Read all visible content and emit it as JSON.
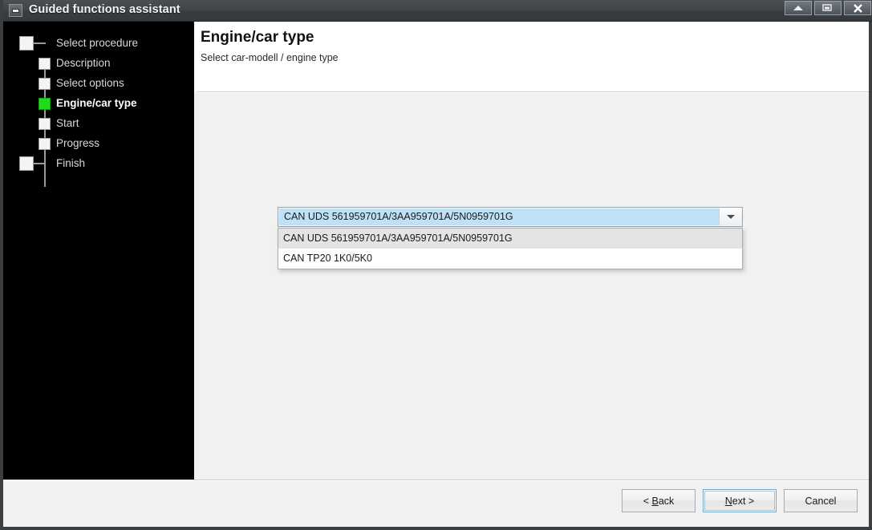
{
  "window": {
    "title": "Guided functions assistant",
    "sysmenu_icon": "window-menu-icon",
    "controls": [
      {
        "name": "minimize-button",
        "icon": "triangle-up-icon"
      },
      {
        "name": "restore-button",
        "icon": "restore-window-icon"
      },
      {
        "name": "close-button",
        "icon": "close-x-icon"
      }
    ]
  },
  "sidebar": {
    "steps": [
      {
        "label": "Select procedure",
        "state": "pending",
        "level": "outer"
      },
      {
        "label": "Description",
        "state": "pending",
        "level": "inner"
      },
      {
        "label": "Select options",
        "state": "pending",
        "level": "inner"
      },
      {
        "label": "Engine/car type",
        "state": "current",
        "level": "inner"
      },
      {
        "label": "Start",
        "state": "pending",
        "level": "inner"
      },
      {
        "label": "Progress",
        "state": "pending",
        "level": "inner"
      },
      {
        "label": "Finish",
        "state": "pending",
        "level": "outer"
      }
    ]
  },
  "header": {
    "title": "Engine/car type",
    "subtitle": "Select car-modell / engine type"
  },
  "main": {
    "combobox": {
      "value": "CAN UDS 561959701A/3AA959701A/5N0959701G",
      "expanded": true,
      "arrow_icon": "chevron-down-icon",
      "options": [
        {
          "label": "CAN UDS 561959701A/3AA959701A/5N0959701G",
          "highlighted": true
        },
        {
          "label": "CAN TP20 1K0/5K0",
          "highlighted": false
        }
      ]
    }
  },
  "footer": {
    "back_label": "< Back",
    "back_accel": "B",
    "next_label": "Next >",
    "next_accel": "N",
    "cancel_label": "Cancel"
  },
  "colors": {
    "titlebar": "#3d4246",
    "sidebar_bg": "#000000",
    "current_step": "#1cdd1c",
    "content_bg": "#f1f1f1",
    "combo_selection": "#bfe0f5",
    "focus_ring": "#6da9d8"
  }
}
